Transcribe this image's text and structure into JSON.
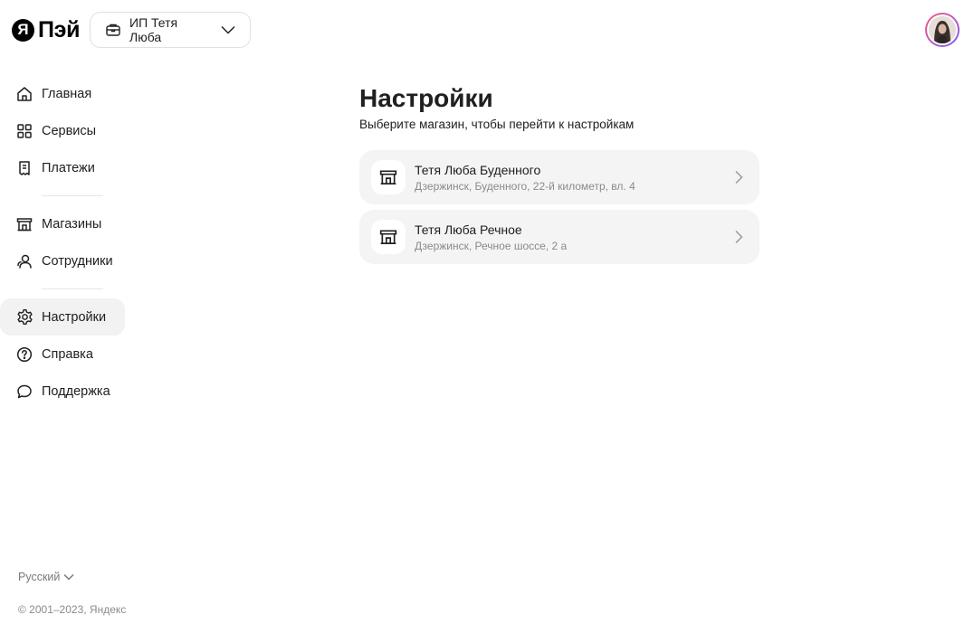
{
  "header": {
    "logo_letter": "Я",
    "logo_text": "Пэй",
    "org_name": "ИП Тетя Люба",
    "org_icon": "briefcase-icon",
    "avatar_icon": "user-avatar"
  },
  "sidebar": {
    "items": [
      {
        "label": "Главная",
        "icon": "home-icon"
      },
      {
        "label": "Сервисы",
        "icon": "grid-icon"
      },
      {
        "label": "Платежи",
        "icon": "receipt-icon"
      },
      {
        "label": "Магазины",
        "icon": "store-icon"
      },
      {
        "label": "Сотрудники",
        "icon": "people-icon"
      },
      {
        "label": "Настройки",
        "icon": "gear-icon",
        "active": true
      },
      {
        "label": "Справка",
        "icon": "help-icon"
      },
      {
        "label": "Поддержка",
        "icon": "chat-icon"
      }
    ],
    "language": "Русский",
    "copyright": "© 2001–2023, Яндекс"
  },
  "main": {
    "title": "Настройки",
    "subtitle": "Выберите магазин, чтобы перейти к настройкам",
    "shops": [
      {
        "name": "Тетя Люба Буденного",
        "address": "Дзержинск, Буденного, 22-й километр, вл. 4"
      },
      {
        "name": "Тетя Люба Речное",
        "address": "Дзержинск, Речное шоссе, 2 а"
      }
    ]
  },
  "colors": {
    "text": "#21201f",
    "muted": "#8a8a8a",
    "card_bg": "#f4f4f4",
    "active_bg": "#f2f2f2",
    "avatar_ring": "#7b5cff"
  }
}
